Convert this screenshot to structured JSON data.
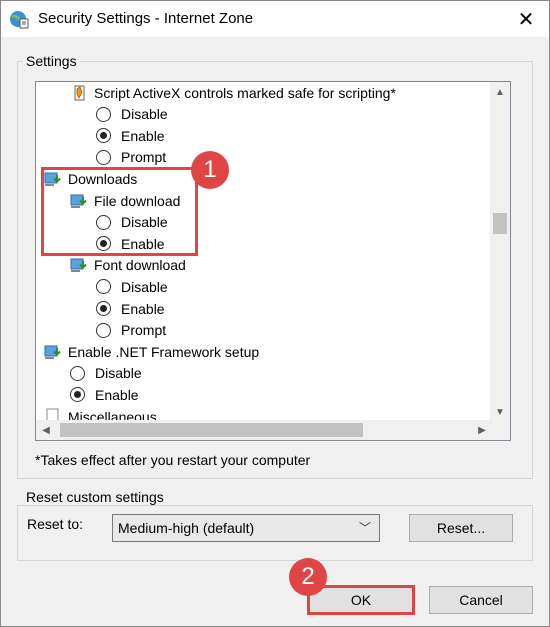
{
  "window": {
    "title": "Security Settings - Internet Zone",
    "close_icon": "close-icon"
  },
  "settings": {
    "group_label": "Settings",
    "items": [
      {
        "type": "header",
        "icon": "script-icon",
        "label": "Script ActiveX controls marked safe for scripting*",
        "indent": 1
      },
      {
        "type": "radio",
        "label": "Disable",
        "checked": false,
        "indent": 2
      },
      {
        "type": "radio",
        "label": "Enable",
        "checked": true,
        "indent": 2
      },
      {
        "type": "radio",
        "label": "Prompt",
        "checked": false,
        "indent": 2
      },
      {
        "type": "header",
        "icon": "downloads-icon",
        "label": "Downloads",
        "indent": 0
      },
      {
        "type": "header",
        "icon": "download-icon",
        "label": "File download",
        "indent": 1
      },
      {
        "type": "radio",
        "label": "Disable",
        "checked": false,
        "indent": 2
      },
      {
        "type": "radio",
        "label": "Enable",
        "checked": true,
        "indent": 2
      },
      {
        "type": "header",
        "icon": "download-icon",
        "label": "Font download",
        "indent": 1
      },
      {
        "type": "radio",
        "label": "Disable",
        "checked": false,
        "indent": 2
      },
      {
        "type": "radio",
        "label": "Enable",
        "checked": true,
        "indent": 2
      },
      {
        "type": "radio",
        "label": "Prompt",
        "checked": false,
        "indent": 2
      },
      {
        "type": "header",
        "icon": "dotnet-icon",
        "label": "Enable .NET Framework setup",
        "indent": 0
      },
      {
        "type": "radio",
        "label": "Disable",
        "checked": false,
        "indent": 1
      },
      {
        "type": "radio",
        "label": "Enable",
        "checked": true,
        "indent": 1
      },
      {
        "type": "header",
        "icon": "page-icon",
        "label": "Miscellaneous",
        "indent": 0
      }
    ],
    "note": "*Takes effect after you restart your computer"
  },
  "reset": {
    "group_label": "Reset custom settings",
    "reset_to_label": "Reset to:",
    "selected": "Medium-high (default)",
    "reset_button": "Reset..."
  },
  "buttons": {
    "ok": "OK",
    "cancel": "Cancel"
  },
  "annotations": {
    "badge1": "1",
    "badge2": "2",
    "highlight_color": "#e04545"
  }
}
